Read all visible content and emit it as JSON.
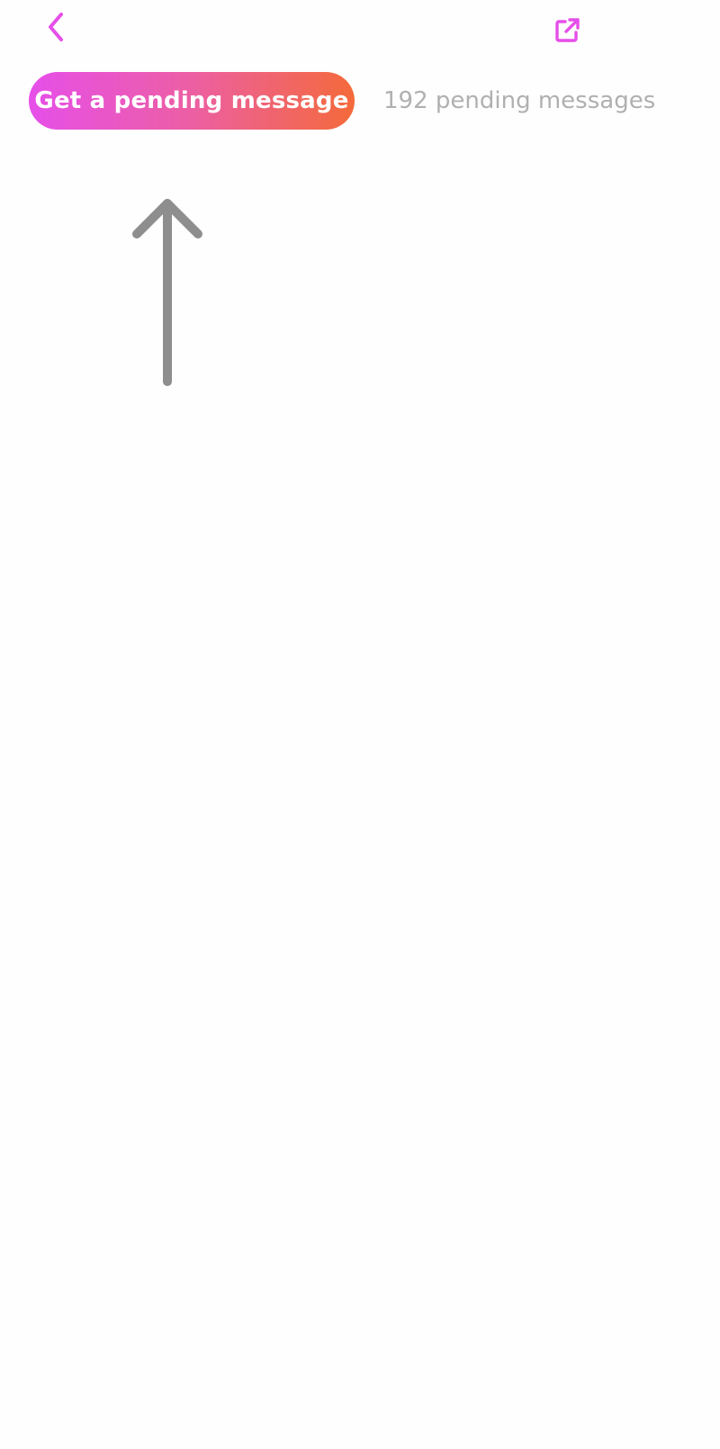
{
  "header": {
    "back_icon": "chevron-left-icon",
    "share_icon": "external-link-icon",
    "accent_color": "#e64fe9"
  },
  "main": {
    "pending_button_label": "Get a pending message",
    "pending_count_text": "192 pending messages",
    "gradient_colors": [
      "#e64fe9",
      "#f46a3a"
    ],
    "hint_icon": "arrow-up-icon"
  }
}
